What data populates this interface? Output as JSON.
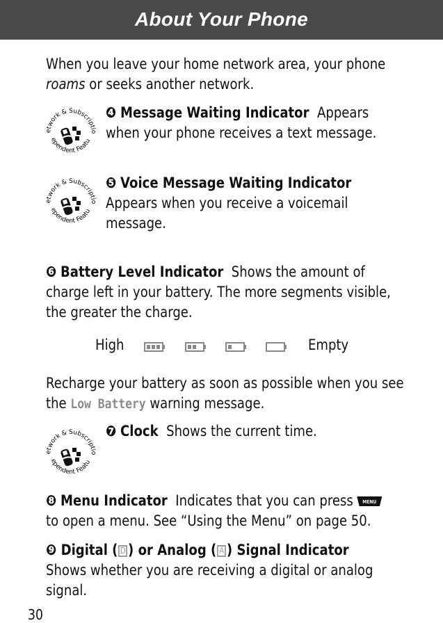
{
  "header": {
    "title": "About Your Phone"
  },
  "intro": {
    "line1": "When you leave your home network area, your phone",
    "roams_word": "roams",
    "line2_rest": " or seeks another network."
  },
  "seal": {
    "top_text": "Network & Subscription",
    "bottom_text": "Dependent Feature"
  },
  "items": {
    "message_waiting": {
      "number": "❹",
      "title": "Message Waiting Indicator",
      "desc_inline": "Appears",
      "desc_rest": "when your phone receives a text message."
    },
    "voice_message": {
      "number": "❺",
      "title": "Voice Message Waiting Indicator",
      "desc_line1": "Appears when you receive a voicemail",
      "desc_line2": "message."
    },
    "battery": {
      "number": "❻",
      "title": "Battery Level Indicator",
      "desc_inline": "Shows the amount of",
      "desc_line2": "charge left in your battery. The more segments visible,",
      "desc_line3": "the greater the charge."
    },
    "clock": {
      "number": "❼",
      "title": "Clock",
      "desc": "Shows the current time."
    },
    "menu": {
      "number": "❽",
      "title": "Menu Indicator",
      "desc_inline": "Indicates that you can press",
      "key_label": "MENU",
      "desc_line2": "to open a menu. See “Using the Menu” on page 50."
    },
    "signal": {
      "number": "❾",
      "title_part1": "Digital (",
      "digital_glyph": "D",
      "title_part2": ") or Analog (",
      "analog_glyph": "A",
      "title_part3": ") Signal Indicator",
      "desc_line1": "Shows whether you are receiving a digital or analog",
      "desc_line2": "signal."
    }
  },
  "battery_scale": {
    "high_label": "High",
    "empty_label": "Empty",
    "levels": [
      3,
      2,
      1,
      0
    ],
    "max_segments": 3
  },
  "recharge": {
    "line1": "Recharge your battery as soon as possible when you see",
    "pre": "the ",
    "warning": "Low Battery",
    "post": " warning message."
  },
  "page_number": "30"
}
